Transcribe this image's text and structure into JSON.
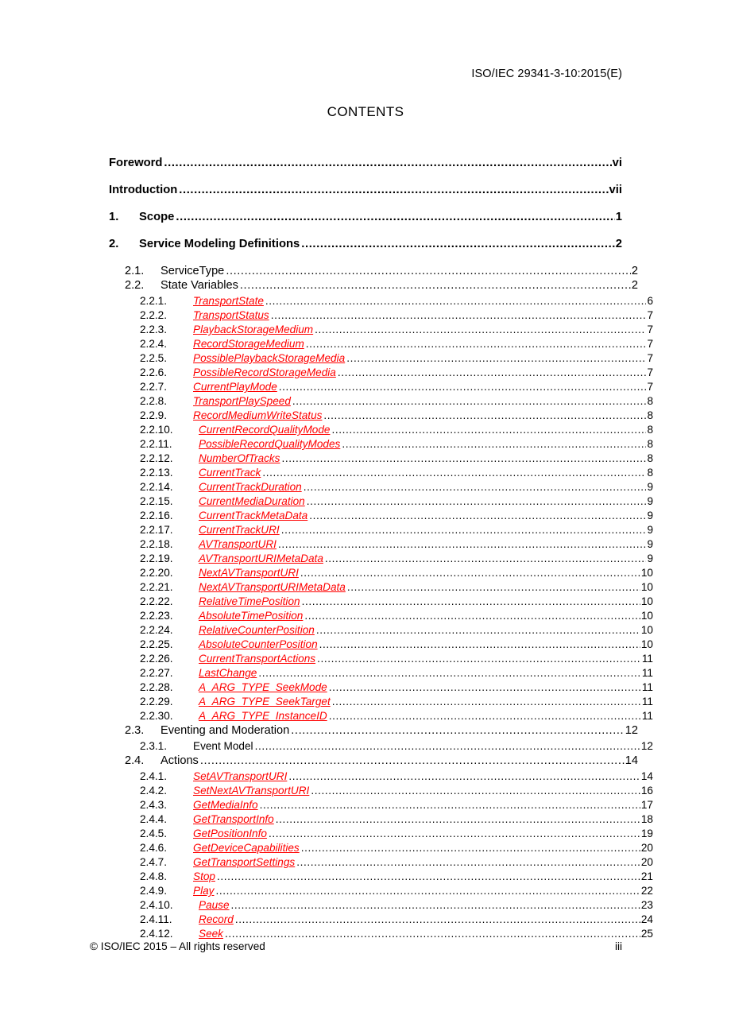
{
  "header": {
    "doc_id": "ISO/IEC 29341-3-10:2015(E)"
  },
  "title": "CONTENTS",
  "footer": {
    "copyright": "© ISO/IEC 2015 – All rights reserved",
    "page_number": "iii"
  },
  "toc": {
    "entries": [
      {
        "level": 0,
        "num": "",
        "label": "Foreword",
        "page": "vi",
        "style": "bold"
      },
      {
        "level": 0,
        "num": "",
        "label": "Introduction",
        "page": "vii",
        "style": "bold"
      },
      {
        "level": 1,
        "num": "1.",
        "label": "Scope",
        "page": "1",
        "style": "bold"
      },
      {
        "level": 1,
        "num": "2.",
        "label": "Service Modeling Definitions",
        "page": "2",
        "style": "bold"
      },
      {
        "level": 2,
        "num": "2.1.",
        "label": "ServiceType",
        "page": "2",
        "style": "plain"
      },
      {
        "level": 2,
        "num": "2.2.",
        "label": "State Variables",
        "page": "2",
        "style": "plain"
      },
      {
        "level": 3,
        "num": "2.2.1.",
        "label": "TransportState",
        "page": "6",
        "style": "red"
      },
      {
        "level": 3,
        "num": "2.2.2.",
        "label": "TransportStatus",
        "page": "7",
        "style": "red"
      },
      {
        "level": 3,
        "num": "2.2.3.",
        "label": "PlaybackStorageMedium",
        "page": "7",
        "style": "red"
      },
      {
        "level": 3,
        "num": "2.2.4.",
        "label": "RecordStorageMedium",
        "page": "7",
        "style": "red"
      },
      {
        "level": 3,
        "num": "2.2.5.",
        "label": "PossiblePlaybackStorageMedia",
        "page": "7",
        "style": "red"
      },
      {
        "level": 3,
        "num": "2.2.6.",
        "label": "PossibleRecordStorageMedia",
        "page": "7",
        "style": "red"
      },
      {
        "level": 3,
        "num": "2.2.7.",
        "label": "CurrentPlayMode",
        "page": "7",
        "style": "red"
      },
      {
        "level": 3,
        "num": "2.2.8.",
        "label": "TransportPlaySpeed",
        "page": "8",
        "style": "red"
      },
      {
        "level": 3,
        "num": "2.2.9.",
        "label": "RecordMediumWriteStatus",
        "page": "8",
        "style": "red"
      },
      {
        "level": 3,
        "num": "2.2.10.",
        "label": "CurrentRecordQualityMode",
        "page": "8",
        "style": "red",
        "wide": true
      },
      {
        "level": 3,
        "num": "2.2.11.",
        "label": "PossibleRecordQualityModes",
        "page": "8",
        "style": "red",
        "wide": true
      },
      {
        "level": 3,
        "num": "2.2.12.",
        "label": "NumberOfTracks",
        "page": "8",
        "style": "red",
        "wide": true
      },
      {
        "level": 3,
        "num": "2.2.13.",
        "label": "CurrentTrack",
        "page": "8",
        "style": "red",
        "wide": true
      },
      {
        "level": 3,
        "num": "2.2.14.",
        "label": "CurrentTrackDuration",
        "page": "9",
        "style": "red",
        "wide": true
      },
      {
        "level": 3,
        "num": "2.2.15.",
        "label": "CurrentMediaDuration",
        "page": "9",
        "style": "red",
        "wide": true
      },
      {
        "level": 3,
        "num": "2.2.16.",
        "label": "CurrentTrackMetaData",
        "page": "9",
        "style": "red",
        "wide": true
      },
      {
        "level": 3,
        "num": "2.2.17.",
        "label": "CurrentTrackURI",
        "page": "9",
        "style": "red",
        "wide": true
      },
      {
        "level": 3,
        "num": "2.2.18.",
        "label": "AVTransportURI",
        "page": "9",
        "style": "red",
        "wide": true
      },
      {
        "level": 3,
        "num": "2.2.19.",
        "label": "AVTransportURIMetaData",
        "page": "9",
        "style": "red",
        "wide": true
      },
      {
        "level": 3,
        "num": "2.2.20.",
        "label": "NextAVTransportURI",
        "page": "10",
        "style": "red",
        "wide": true
      },
      {
        "level": 3,
        "num": "2.2.21.",
        "label": "NextAVTransportURIMetaData",
        "page": "10",
        "style": "red",
        "wide": true
      },
      {
        "level": 3,
        "num": "2.2.22.",
        "label": "RelativeTimePosition",
        "page": "10",
        "style": "red",
        "wide": true
      },
      {
        "level": 3,
        "num": "2.2.23.",
        "label": "AbsoluteTimePosition",
        "page": "10",
        "style": "red",
        "wide": true
      },
      {
        "level": 3,
        "num": "2.2.24.",
        "label": "RelativeCounterPosition",
        "page": "10",
        "style": "red",
        "wide": true
      },
      {
        "level": 3,
        "num": "2.2.25.",
        "label": "AbsoluteCounterPosition",
        "page": "10",
        "style": "red",
        "wide": true
      },
      {
        "level": 3,
        "num": "2.2.26.",
        "label": "CurrentTransportActions",
        "page": "11",
        "style": "red",
        "wide": true
      },
      {
        "level": 3,
        "num": "2.2.27.",
        "label": "LastChange",
        "page": "11",
        "style": "red",
        "wide": true
      },
      {
        "level": 3,
        "num": "2.2.28.",
        "label": "A_ARG_TYPE_SeekMode",
        "page": "11",
        "style": "red",
        "wide": true
      },
      {
        "level": 3,
        "num": "2.2.29.",
        "label": "A_ARG_TYPE_SeekTarget",
        "page": "11",
        "style": "red",
        "wide": true
      },
      {
        "level": 3,
        "num": "2.2.30.",
        "label": "A_ARG_TYPE_InstanceID",
        "page": "11",
        "style": "red",
        "wide": true
      },
      {
        "level": 2,
        "num": "2.3.",
        "label": "Eventing and Moderation",
        "page": "12",
        "style": "plain"
      },
      {
        "level": 3,
        "num": "2.3.1.",
        "label": "Event Model",
        "page": "12",
        "style": "plain"
      },
      {
        "level": 2,
        "num": "2.4.",
        "label": "Actions",
        "page": "14",
        "style": "plain"
      },
      {
        "level": 3,
        "num": "2.4.1.",
        "label": "SetAVTransportURI",
        "page": "14",
        "style": "red"
      },
      {
        "level": 3,
        "num": "2.4.2.",
        "label": "SetNextAVTransportURI",
        "page": "16",
        "style": "red"
      },
      {
        "level": 3,
        "num": "2.4.3.",
        "label": "GetMediaInfo",
        "page": "17",
        "style": "red"
      },
      {
        "level": 3,
        "num": "2.4.4.",
        "label": "GetTransportInfo",
        "page": "18",
        "style": "red"
      },
      {
        "level": 3,
        "num": "2.4.5.",
        "label": "GetPositionInfo",
        "page": "19",
        "style": "red"
      },
      {
        "level": 3,
        "num": "2.4.6.",
        "label": "GetDeviceCapabilities",
        "page": "20",
        "style": "red"
      },
      {
        "level": 3,
        "num": "2.4.7.",
        "label": "GetTransportSettings",
        "page": "20",
        "style": "red"
      },
      {
        "level": 3,
        "num": "2.4.8.",
        "label": "Stop",
        "page": "21",
        "style": "red"
      },
      {
        "level": 3,
        "num": "2.4.9.",
        "label": "Play",
        "page": "22",
        "style": "red"
      },
      {
        "level": 3,
        "num": "2.4.10.",
        "label": "Pause",
        "page": "23",
        "style": "red",
        "wide": true
      },
      {
        "level": 3,
        "num": "2.4.11.",
        "label": "Record",
        "page": "24",
        "style": "red",
        "wide": true
      },
      {
        "level": 3,
        "num": "2.4.12.",
        "label": "Seek",
        "page": "25",
        "style": "red",
        "wide": true
      }
    ]
  }
}
